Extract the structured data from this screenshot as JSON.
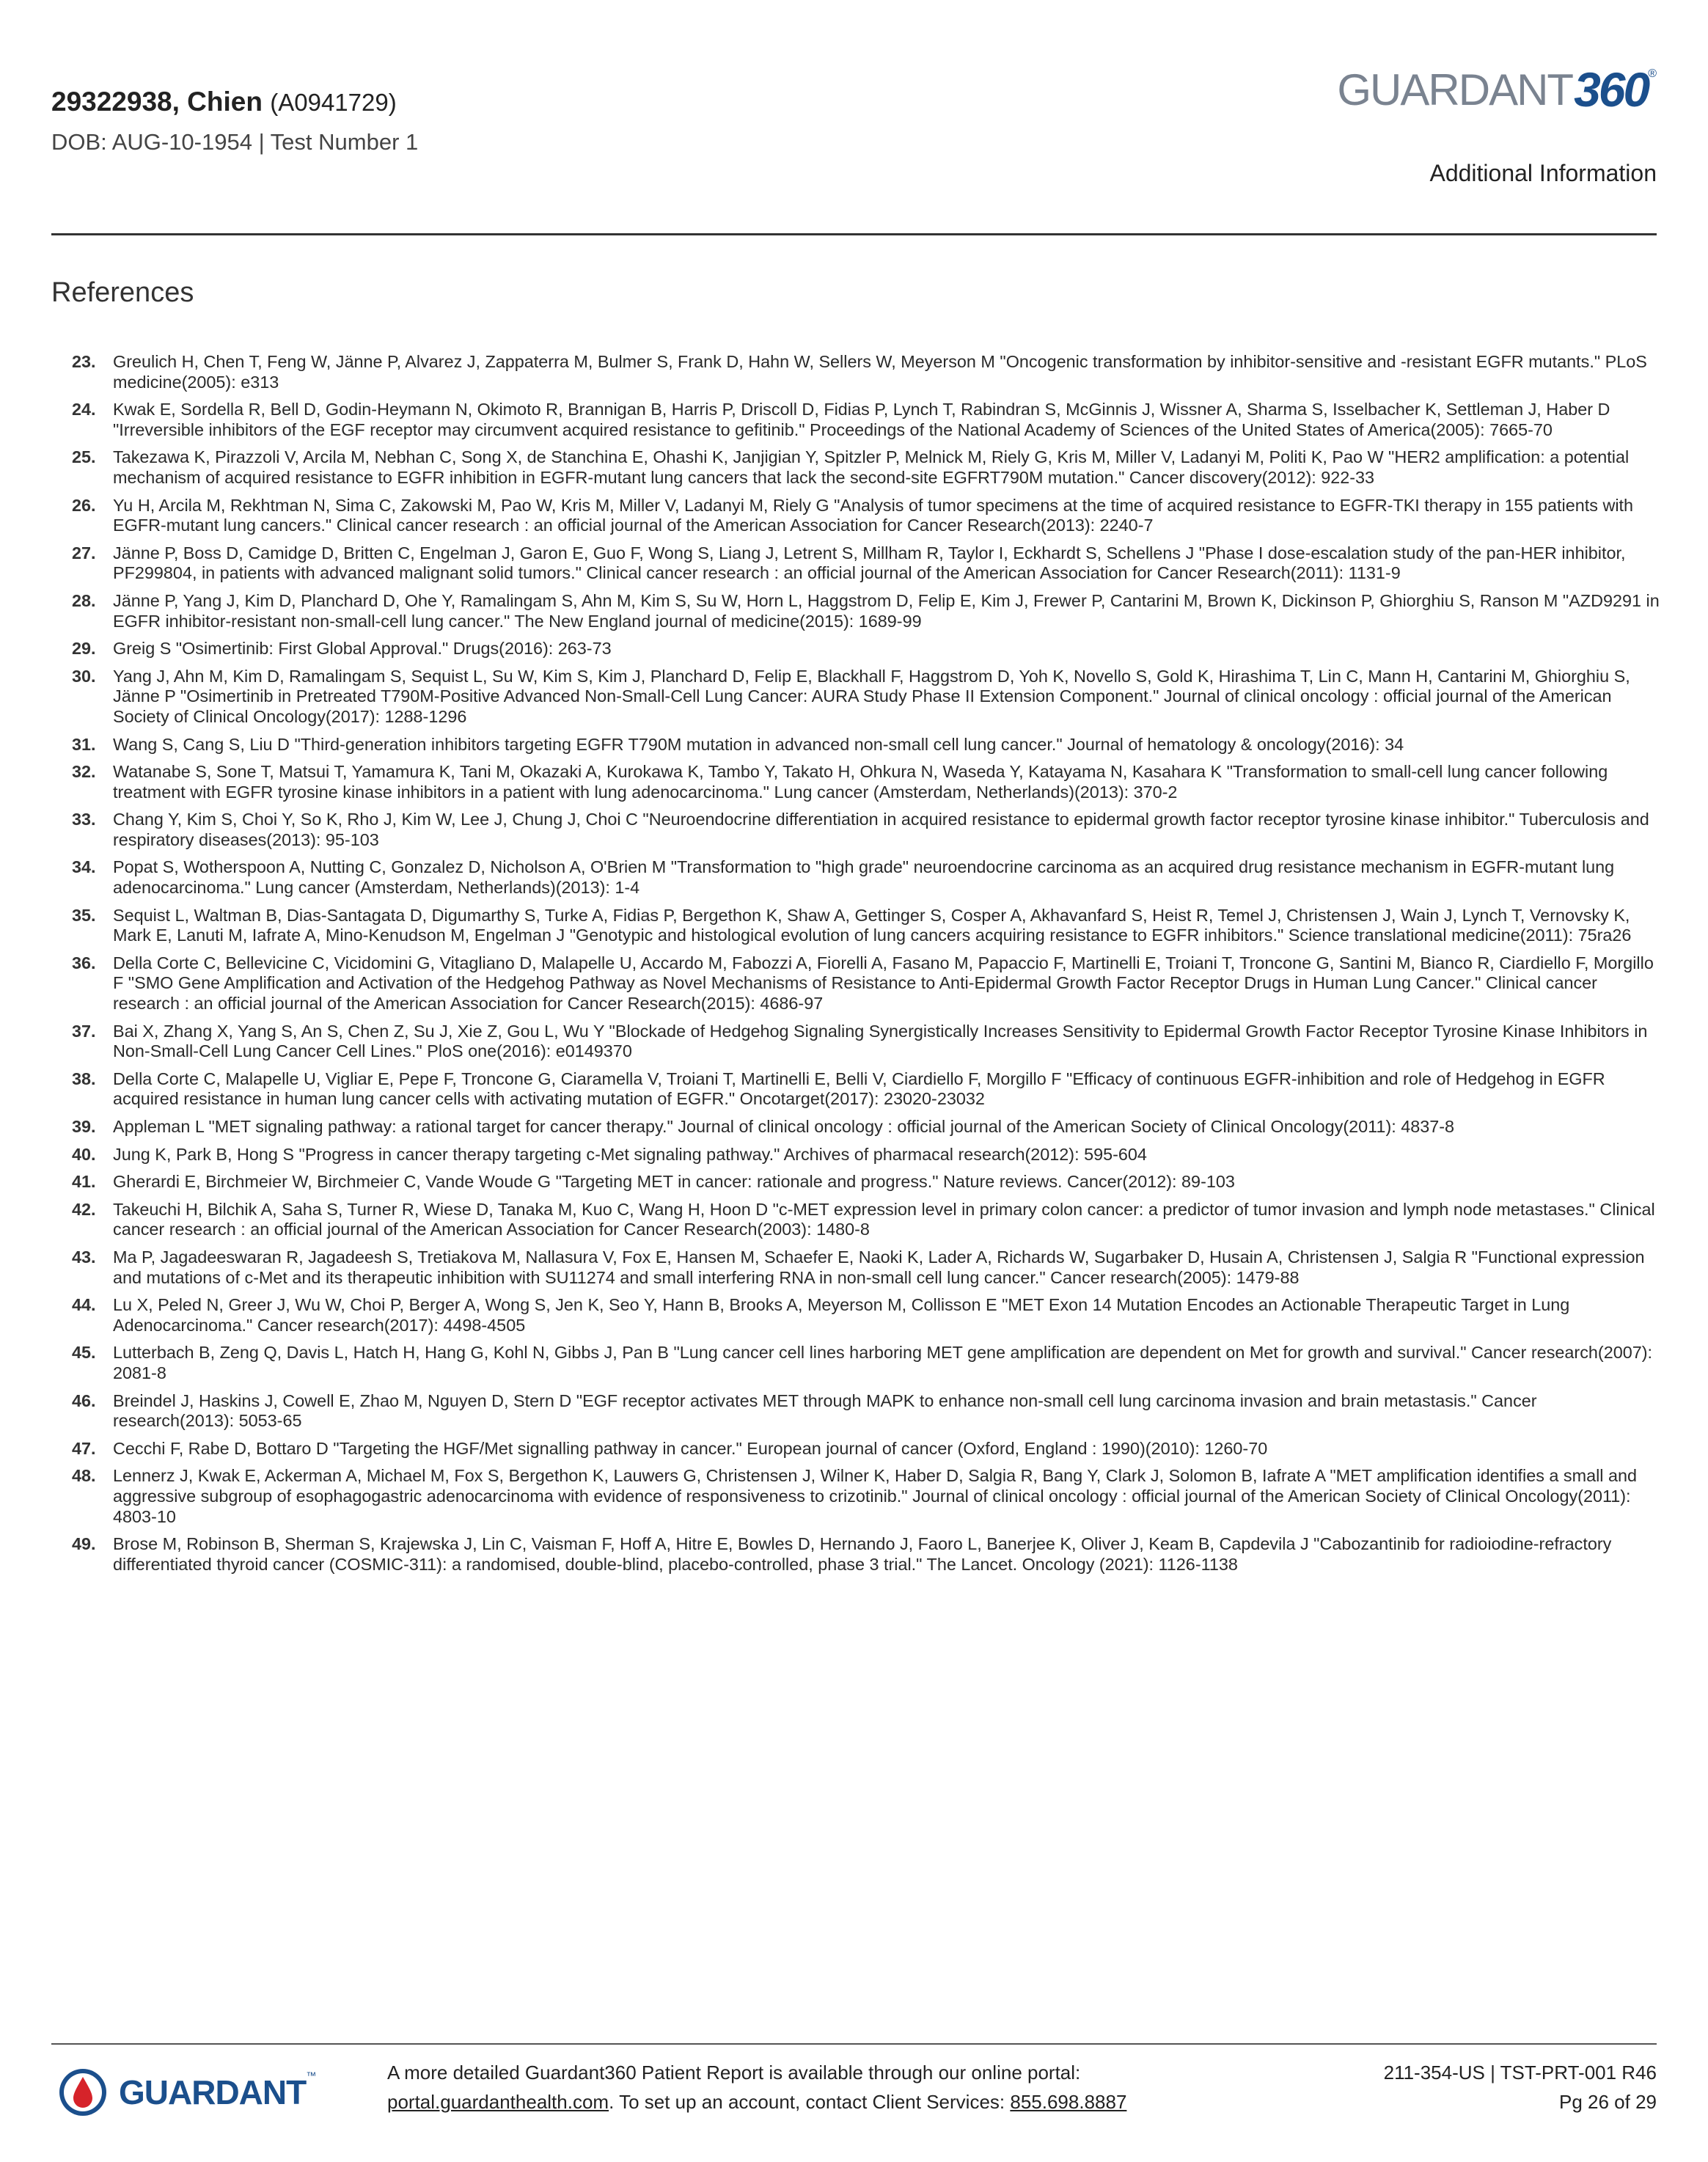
{
  "header": {
    "patient": "29322938, Chien",
    "accession": "(A0941729)",
    "dob_line": "DOB: AUG-10-1954 | Test Number 1",
    "logo_word": "GUARDANT",
    "logo_num": "360",
    "logo_reg": "®",
    "section": "Additional Information"
  },
  "references": {
    "title": "References",
    "items": [
      {
        "num": "23.",
        "text": "Greulich H, Chen T, Feng W, Jänne P, Alvarez J, Zappaterra M, Bulmer S, Frank D, Hahn W, Sellers W, Meyerson M \"Oncogenic transformation by inhibitor-sensitive and -resistant EGFR mutants.\" PLoS medicine(2005): e313"
      },
      {
        "num": "24.",
        "text": "Kwak E, Sordella R, Bell D, Godin-Heymann N, Okimoto R, Brannigan B, Harris P, Driscoll D, Fidias P, Lynch T, Rabindran S, McGinnis J, Wissner A, Sharma S, Isselbacher K, Settleman J, Haber D \"Irreversible inhibitors of the EGF receptor may circumvent acquired resistance to gefitinib.\" Proceedings of the National Academy of Sciences of the United States of America(2005): 7665-70"
      },
      {
        "num": "25.",
        "text": "Takezawa K, Pirazzoli V, Arcila M, Nebhan C, Song X, de Stanchina E, Ohashi K, Janjigian Y, Spitzler P, Melnick M, Riely G, Kris M, Miller V, Ladanyi M, Politi K, Pao W \"HER2 amplification: a potential mechanism of acquired resistance to EGFR inhibition in EGFR-mutant lung cancers that lack the second-site EGFRT790M mutation.\" Cancer discovery(2012): 922-33"
      },
      {
        "num": "26.",
        "text": "Yu H, Arcila M, Rekhtman N, Sima C, Zakowski M, Pao W, Kris M, Miller V, Ladanyi M, Riely G \"Analysis of tumor specimens at the time of acquired resistance to EGFR-TKI therapy in 155 patients with EGFR-mutant lung cancers.\" Clinical cancer research : an official journal of the American Association for Cancer Research(2013): 2240-7"
      },
      {
        "num": "27.",
        "text": "Jänne P, Boss D, Camidge D, Britten C, Engelman J, Garon E, Guo F, Wong S, Liang J, Letrent S, Millham R, Taylor I, Eckhardt S, Schellens J \"Phase I dose-escalation study of the pan-HER inhibitor, PF299804, in patients with advanced malignant solid tumors.\" Clinical cancer research : an official journal of the American Association for Cancer Research(2011): 1131-9"
      },
      {
        "num": "28.",
        "text": "Jänne P, Yang J, Kim D, Planchard D, Ohe Y, Ramalingam S, Ahn M, Kim S, Su W, Horn L, Haggstrom D, Felip E, Kim J, Frewer P, Cantarini M, Brown K, Dickinson P, Ghiorghiu S, Ranson M \"AZD9291 in EGFR inhibitor-resistant non-small-cell lung cancer.\" The New England journal of medicine(2015): 1689-99"
      },
      {
        "num": "29.",
        "text": "Greig S \"Osimertinib: First Global Approval.\" Drugs(2016): 263-73"
      },
      {
        "num": "30.",
        "text": "Yang J, Ahn M, Kim D, Ramalingam S, Sequist L, Su W, Kim S, Kim J, Planchard D, Felip E, Blackhall F, Haggstrom D, Yoh K, Novello S, Gold K, Hirashima T, Lin C, Mann H, Cantarini M, Ghiorghiu S, Jänne P \"Osimertinib in Pretreated T790M-Positive Advanced Non-Small-Cell Lung Cancer: AURA Study Phase II Extension Component.\" Journal of clinical oncology : official journal of the American Society of Clinical Oncology(2017): 1288-1296"
      },
      {
        "num": "31.",
        "text": "Wang S, Cang S, Liu D \"Third-generation inhibitors targeting EGFR T790M mutation in advanced non-small cell lung cancer.\" Journal of hematology & oncology(2016): 34"
      },
      {
        "num": "32.",
        "text": "Watanabe S, Sone T, Matsui T, Yamamura K, Tani M, Okazaki A, Kurokawa K, Tambo Y, Takato H, Ohkura N, Waseda Y, Katayama N, Kasahara K \"Transformation to small-cell lung cancer following treatment with EGFR tyrosine kinase inhibitors in a patient with lung adenocarcinoma.\" Lung cancer (Amsterdam, Netherlands)(2013): 370-2"
      },
      {
        "num": "33.",
        "text": "Chang Y, Kim S, Choi Y, So K, Rho J, Kim W, Lee J, Chung J, Choi C \"Neuroendocrine differentiation in acquired resistance to epidermal growth factor receptor tyrosine kinase inhibitor.\" Tuberculosis and respiratory diseases(2013): 95-103"
      },
      {
        "num": "34.",
        "text": "Popat S, Wotherspoon A, Nutting C, Gonzalez D, Nicholson A, O'Brien M \"Transformation to \"high grade\" neuroendocrine carcinoma as an acquired drug resistance mechanism in EGFR-mutant lung adenocarcinoma.\" Lung cancer (Amsterdam, Netherlands)(2013): 1-4"
      },
      {
        "num": "35.",
        "text": "Sequist L, Waltman B, Dias-Santagata D, Digumarthy S, Turke A, Fidias P, Bergethon K, Shaw A, Gettinger S, Cosper A, Akhavanfard S, Heist R, Temel J, Christensen J, Wain J, Lynch T, Vernovsky K, Mark E, Lanuti M, Iafrate A, Mino-Kenudson M, Engelman J \"Genotypic and histological evolution of lung cancers acquiring resistance to EGFR inhibitors.\" Science translational medicine(2011): 75ra26"
      },
      {
        "num": "36.",
        "text": "Della Corte C, Bellevicine C, Vicidomini G, Vitagliano D, Malapelle U, Accardo M, Fabozzi A, Fiorelli A, Fasano M, Papaccio F, Martinelli E, Troiani T, Troncone G, Santini M, Bianco R, Ciardiello F, Morgillo F \"SMO Gene Amplification and Activation of the Hedgehog Pathway as Novel Mechanisms of Resistance to Anti-Epidermal Growth Factor Receptor Drugs in Human Lung Cancer.\" Clinical cancer research : an official journal of the American Association for Cancer Research(2015): 4686-97"
      },
      {
        "num": "37.",
        "text": "Bai X, Zhang X, Yang S, An S, Chen Z, Su J, Xie Z, Gou L, Wu Y \"Blockade of Hedgehog Signaling Synergistically Increases Sensitivity to Epidermal Growth Factor Receptor Tyrosine Kinase Inhibitors in Non-Small-Cell Lung Cancer Cell Lines.\" PloS one(2016): e0149370"
      },
      {
        "num": "38.",
        "text": "Della Corte C, Malapelle U, Vigliar E, Pepe F, Troncone G, Ciaramella V, Troiani T, Martinelli E, Belli V, Ciardiello F, Morgillo F \"Efficacy of continuous EGFR-inhibition and role of Hedgehog in EGFR acquired resistance in human lung cancer cells with activating mutation of EGFR.\" Oncotarget(2017): 23020-23032"
      },
      {
        "num": "39.",
        "text": "Appleman L \"MET signaling pathway: a rational target for cancer therapy.\" Journal of clinical oncology : official journal of the American Society of Clinical Oncology(2011): 4837-8"
      },
      {
        "num": "40.",
        "text": "Jung K, Park B, Hong S \"Progress in cancer therapy targeting c-Met signaling pathway.\" Archives of pharmacal research(2012): 595-604"
      },
      {
        "num": "41.",
        "text": "Gherardi E, Birchmeier W, Birchmeier C, Vande Woude G \"Targeting MET in cancer: rationale and progress.\" Nature reviews. Cancer(2012): 89-103"
      },
      {
        "num": "42.",
        "text": "Takeuchi H, Bilchik A, Saha S, Turner R, Wiese D, Tanaka M, Kuo C, Wang H, Hoon D \"c-MET expression level in primary colon cancer: a predictor of tumor invasion and lymph node metastases.\" Clinical cancer research : an official journal of the American Association for Cancer Research(2003): 1480-8"
      },
      {
        "num": "43.",
        "text": "Ma P, Jagadeeswaran R, Jagadeesh S, Tretiakova M, Nallasura V, Fox E, Hansen M, Schaefer E, Naoki K, Lader A, Richards W, Sugarbaker D, Husain A, Christensen J, Salgia R \"Functional expression and mutations of c-Met and its therapeutic inhibition with SU11274 and small interfering RNA in non-small cell lung cancer.\" Cancer research(2005): 1479-88"
      },
      {
        "num": "44.",
        "text": "Lu X, Peled N, Greer J, Wu W, Choi P, Berger A, Wong S, Jen K, Seo Y, Hann B, Brooks A, Meyerson M, Collisson E \"MET Exon 14 Mutation Encodes an Actionable Therapeutic Target in Lung Adenocarcinoma.\" Cancer research(2017): 4498-4505"
      },
      {
        "num": "45.",
        "text": "Lutterbach B, Zeng Q, Davis L, Hatch H, Hang G, Kohl N, Gibbs J, Pan B \"Lung cancer cell lines harboring MET gene amplification are dependent on Met for growth and survival.\" Cancer research(2007): 2081-8"
      },
      {
        "num": "46.",
        "text": "Breindel J, Haskins J, Cowell E, Zhao M, Nguyen D, Stern D \"EGF receptor activates MET through MAPK to enhance non-small cell lung carcinoma invasion and brain metastasis.\" Cancer research(2013): 5053-65"
      },
      {
        "num": "47.",
        "text": "Cecchi F, Rabe D, Bottaro D \"Targeting the HGF/Met signalling pathway in cancer.\" European journal of cancer (Oxford, England : 1990)(2010): 1260-70"
      },
      {
        "num": "48.",
        "text": "Lennerz J, Kwak E, Ackerman A, Michael M, Fox S, Bergethon K, Lauwers G, Christensen J, Wilner K, Haber D, Salgia R, Bang Y, Clark J, Solomon B, Iafrate A \"MET amplification identifies a small and aggressive subgroup of esophagogastric adenocarcinoma with evidence of responsiveness to crizotinib.\" Journal of clinical oncology : official journal of the American Society of Clinical Oncology(2011): 4803-10"
      },
      {
        "num": "49.",
        "text": "Brose M, Robinson B, Sherman S, Krajewska J, Lin C, Vaisman F, Hoff A, Hitre E, Bowles D, Hernando J, Faoro L, Banerjee K, Oliver J, Keam B, Capdevila J \"Cabozantinib for radioiodine-refractory differentiated thyroid cancer (COSMIC-311): a randomised, double-blind, placebo-controlled, phase 3 trial.\" The Lancet. Oncology (2021): 1126-1138"
      }
    ]
  },
  "footer": {
    "logo_word": "GUARDANT",
    "logo_tm": "™",
    "line1": "A more detailed Guardant360 Patient Report is available through our online portal:",
    "portal_link": "portal.guardanthealth.com",
    "line2_mid": ". To set up an account, contact Client Services: ",
    "phone": "855.698.8887",
    "doc_id": "211-354-US | TST-PRT-001 R46",
    "page": "Pg 26 of 29"
  }
}
